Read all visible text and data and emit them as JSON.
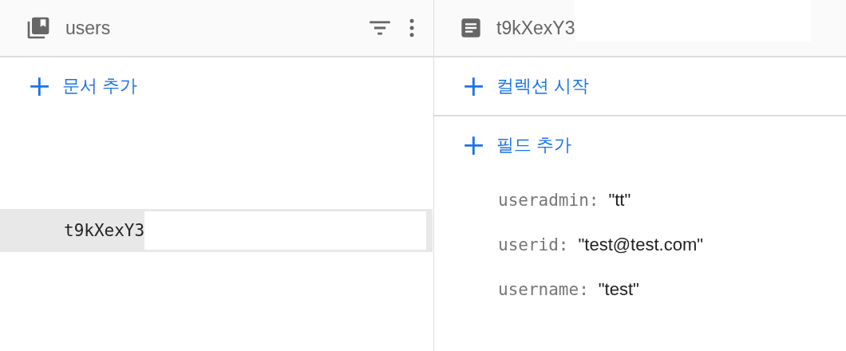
{
  "collection_panel": {
    "title": "users",
    "add_label": "문서 추가",
    "documents": [
      {
        "id": "t9kXexY3",
        "selected": true,
        "redacted": true
      }
    ]
  },
  "document_panel": {
    "title": "t9kXexY3",
    "title_redacted": true,
    "start_collection_label": "컬렉션 시작",
    "add_field_label": "필드 추가",
    "fields": [
      {
        "key": "useradmin:",
        "value": "\"tt\""
      },
      {
        "key": "userid:",
        "value": "\"test@test.com\""
      },
      {
        "key": "username:",
        "value": "\"test\""
      }
    ]
  }
}
